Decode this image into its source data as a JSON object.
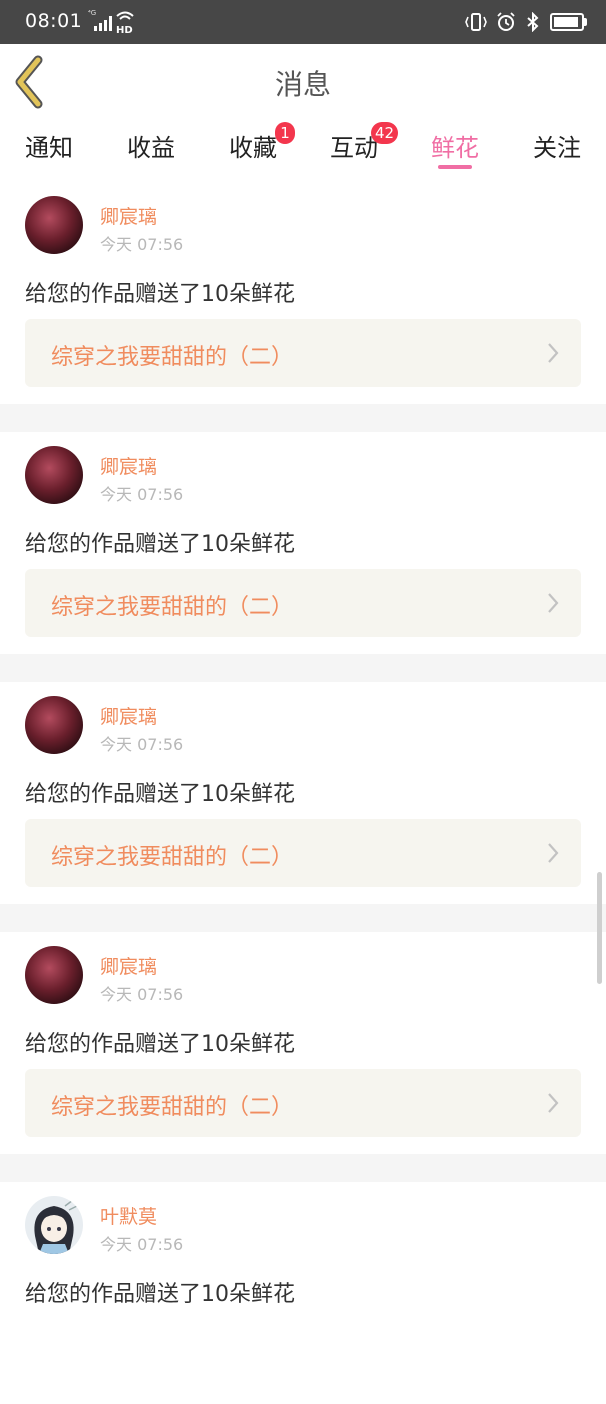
{
  "status_bar": {
    "time": "08:01",
    "network_small": "⁴G",
    "hd": "HD"
  },
  "header": {
    "title": "消息",
    "back_icon": "chevron-left-icon",
    "accent": "#e2c45a"
  },
  "tabs": [
    {
      "label": "通知"
    },
    {
      "label": "收益"
    },
    {
      "label": "收藏",
      "badge": "1"
    },
    {
      "label": "互动",
      "badge": "42"
    },
    {
      "label": "鲜花",
      "active": true
    },
    {
      "label": "关注"
    }
  ],
  "colors": {
    "active_tab": "#f06ea4",
    "badge": "#f3364d",
    "username": "#f08c5e",
    "link_bg": "#f6f5ef"
  },
  "messages": [
    {
      "user": "卿宸璃",
      "time": "今天 07:56",
      "text": "给您的作品赠送了10朵鲜花",
      "work": "综穿之我要甜甜的（二）"
    },
    {
      "user": "卿宸璃",
      "time": "今天 07:56",
      "text": "给您的作品赠送了10朵鲜花",
      "work": "综穿之我要甜甜的（二）"
    },
    {
      "user": "卿宸璃",
      "time": "今天 07:56",
      "text": "给您的作品赠送了10朵鲜花",
      "work": "综穿之我要甜甜的（二）"
    },
    {
      "user": "卿宸璃",
      "time": "今天 07:56",
      "text": "给您的作品赠送了10朵鲜花",
      "work": "综穿之我要甜甜的（二）"
    },
    {
      "user": "叶默莫",
      "time": "今天 07:56",
      "text": "给您的作品赠送了10朵鲜花",
      "work": ""
    }
  ]
}
